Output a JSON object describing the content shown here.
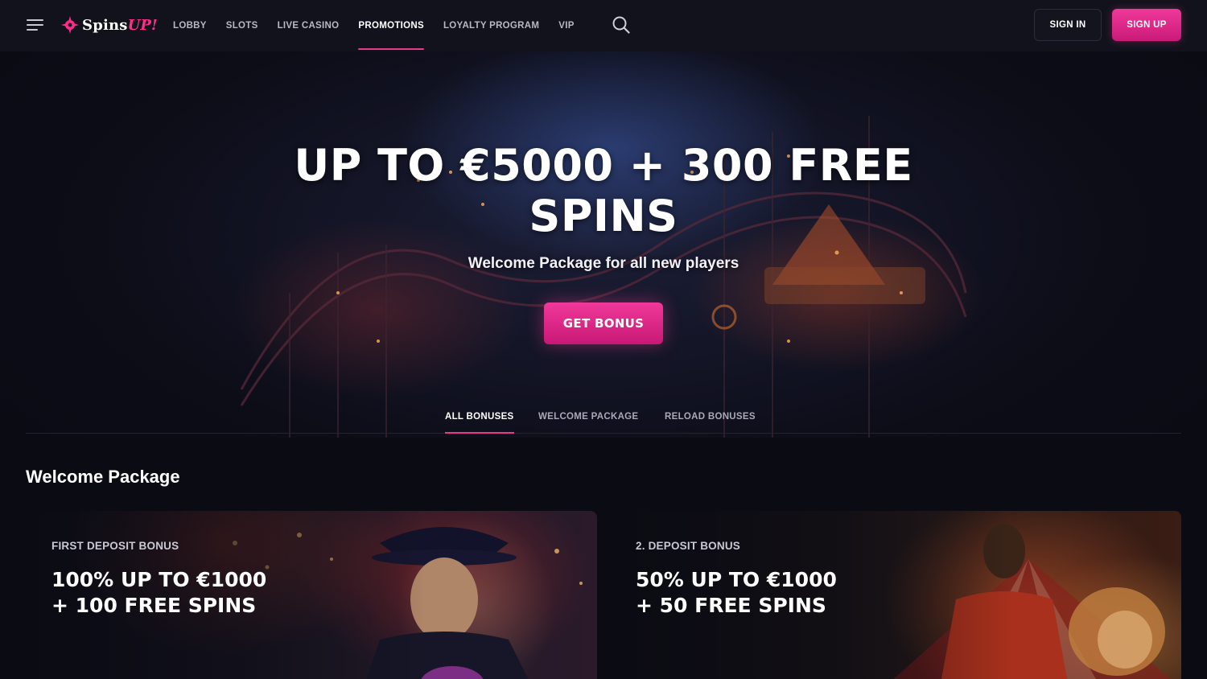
{
  "header": {
    "logo": {
      "part_a": "Spins",
      "part_b": "UP!"
    },
    "nav": [
      {
        "label": "LOBBY",
        "active": false
      },
      {
        "label": "SLOTS",
        "active": false
      },
      {
        "label": "LIVE CASINO",
        "active": false
      },
      {
        "label": "PROMOTIONS",
        "active": true
      },
      {
        "label": "LOYALTY PROGRAM",
        "active": false
      },
      {
        "label": "VIP",
        "active": false
      }
    ],
    "sign_in": "SIGN IN",
    "sign_up": "SIGN UP"
  },
  "hero": {
    "title_line1": "UP TO €5000 + 300 FREE",
    "title_line2": "SPINS",
    "subtitle": "Welcome Package for all new players",
    "cta": "GET BONUS"
  },
  "tabs": [
    {
      "label": "ALL BONUSES",
      "active": true
    },
    {
      "label": "WELCOME PACKAGE",
      "active": false
    },
    {
      "label": "RELOAD BONUSES",
      "active": false
    }
  ],
  "section": {
    "title": "Welcome Package",
    "cards": [
      {
        "kicker": "FIRST DEPOSIT BONUS",
        "line1": "100% UP TO €1000",
        "line2": "+ 100 FREE SPINS"
      },
      {
        "kicker": "2. DEPOSIT BONUS",
        "line1": "50% UP TO €1000",
        "line2": "+ 50 FREE SPINS"
      }
    ]
  },
  "colors": {
    "accent": "#e8398c",
    "background": "#0b0b14",
    "header": "#12121c"
  }
}
